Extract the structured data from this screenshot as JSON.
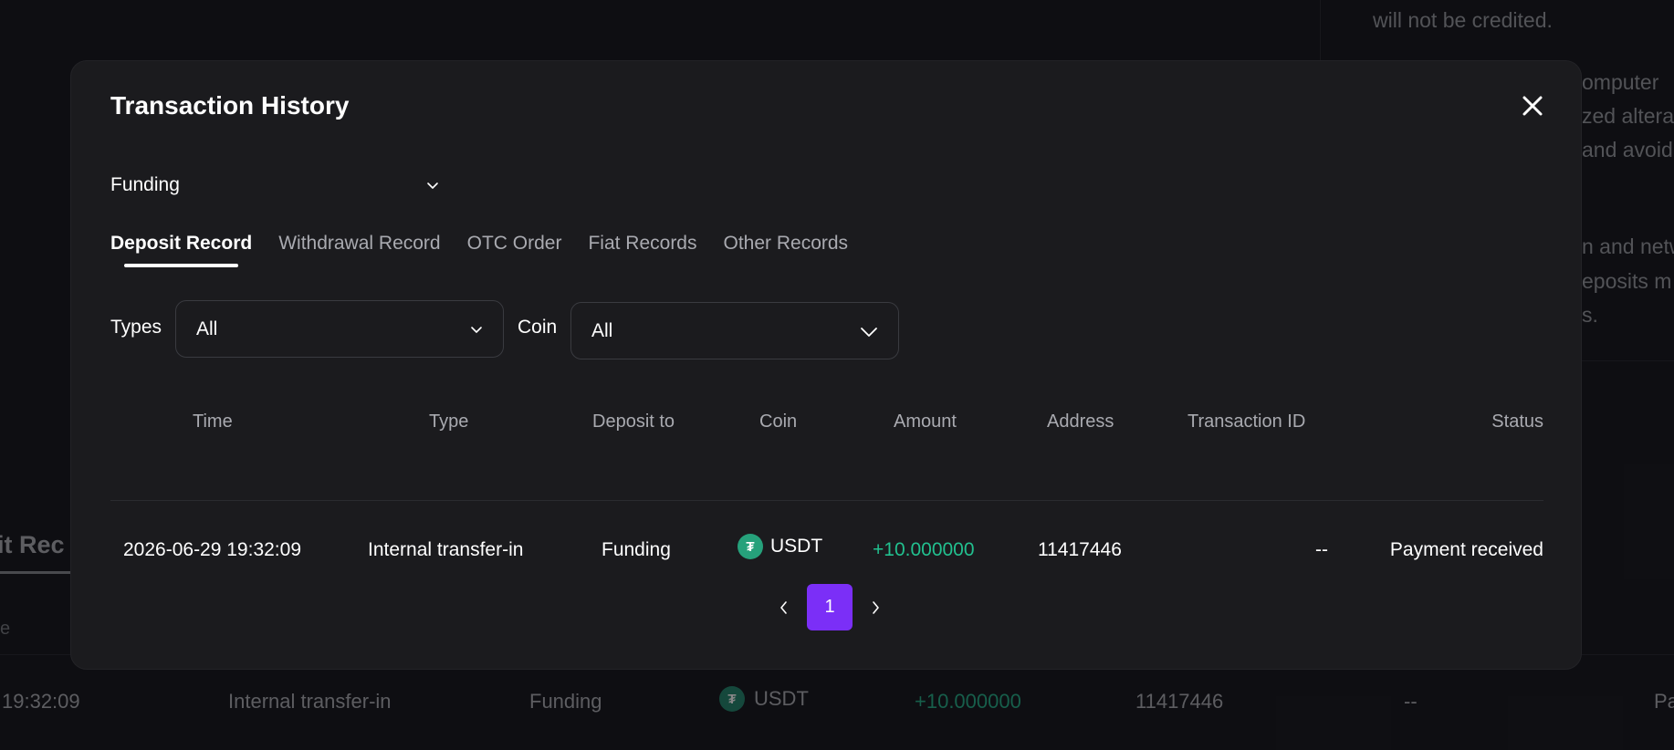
{
  "background": {
    "notice_lines": [
      "will not be credited.",
      "omputer",
      "zed altera",
      "and avoid",
      "n and netw",
      "eposits m",
      "s."
    ],
    "tab_title": "sit Rec",
    "header_fragment": "e",
    "row": {
      "time": "19:32:09",
      "type": "Internal transfer-in",
      "deposit_to": "Funding",
      "coin": "USDT",
      "amount": "+10.000000",
      "address": "11417446",
      "transaction_id": "--",
      "status": "Pa"
    }
  },
  "modal": {
    "title": "Transaction History",
    "account_select": {
      "value": "Funding"
    },
    "tabs": [
      {
        "label": "Deposit Record",
        "active": true
      },
      {
        "label": "Withdrawal Record",
        "active": false
      },
      {
        "label": "OTC Order",
        "active": false
      },
      {
        "label": "Fiat Records",
        "active": false
      },
      {
        "label": "Other Records",
        "active": false
      }
    ],
    "filters": {
      "types_label": "Types",
      "types_value": "All",
      "coin_label": "Coin",
      "coin_value": "All"
    },
    "table": {
      "columns": [
        "Time",
        "Type",
        "Deposit to",
        "Coin",
        "Amount",
        "Address",
        "Transaction ID",
        "Status"
      ],
      "rows": [
        {
          "time": "2026-06-29 19:32:09",
          "type": "Internal transfer-in",
          "deposit_to": "Funding",
          "coin": "USDT",
          "amount": "+10.000000",
          "address": "11417446",
          "transaction_id": "--",
          "status": "Payment received"
        }
      ]
    },
    "pagination": {
      "current_page": "1"
    }
  },
  "colors": {
    "accent": "#7b2ff7",
    "positive": "#22c08f",
    "usdt": "#26a17b",
    "modal_bg": "#1b1b1e"
  },
  "icons": {
    "close": "close-icon",
    "dropdown": "chevron-down-icon",
    "coin": "usdt-icon",
    "prev": "chevron-left-icon",
    "next": "chevron-right-icon"
  }
}
